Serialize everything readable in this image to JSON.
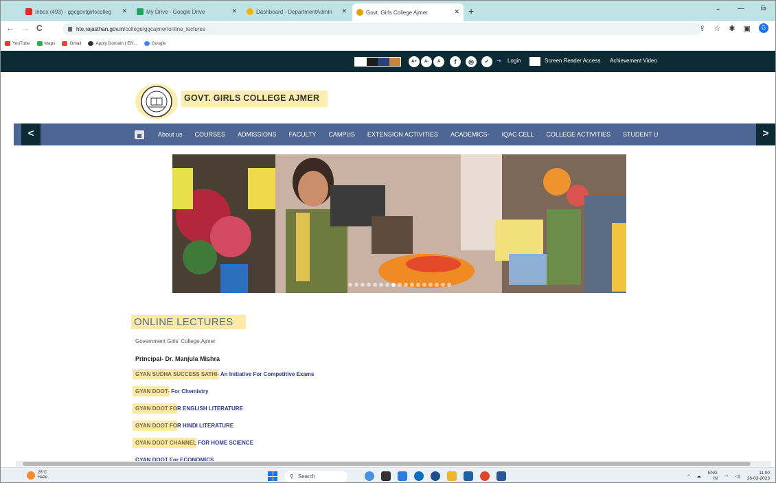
{
  "browser": {
    "tabs": [
      {
        "title": "Inbox (493) - ggcgovtgirlscolleg",
        "color": "#d93025"
      },
      {
        "title": "My Drive - Google Drive",
        "color": "#1fa463"
      },
      {
        "title": "Dashboard - DepartmentAdmin",
        "color": "#f5b400"
      },
      {
        "title": "Govt. Girls College Ajmer",
        "color": "#e8a100"
      }
    ],
    "new_tab": "+",
    "url_host": "hte.rajasthan.gov.in",
    "url_path": "/college/ggcajmer/online_lectures",
    "profile_initial": "G",
    "bookmarks": [
      "YouTube",
      "Maps",
      "Gmail",
      "Apply Domain | ER...",
      "Google"
    ]
  },
  "site_top": {
    "font_buttons": [
      "A+",
      "A-",
      "A"
    ],
    "login": "Login",
    "screen_reader": "Screen Reader Access",
    "achievement": "Achievement Video",
    "color_swatches": [
      "#ffffff",
      "#1c1c1c",
      "#2b3f7a",
      "#c8843a"
    ]
  },
  "header": {
    "college_name": "GOVT. GIRLS COLLEGE AJMER"
  },
  "nav": {
    "prev": "<",
    "next": ">",
    "items": [
      "About us",
      "COURSES",
      "ADMISSIONS",
      "FACULTY",
      "CAMPUS",
      "EXTENSION ACTIVITIES",
      "ACADEMICS-",
      "IQAC CELL",
      "COLLEGE ACTIVITIES",
      "STUDENT U"
    ]
  },
  "slider": {
    "dot_count": 17,
    "active_dot": 7
  },
  "content": {
    "heading": "ONLINE LECTURES",
    "subline": "Government Girls' College,Ajmer",
    "principal": "Principal- Dr. Manjula Mishra",
    "lectures": [
      {
        "prefix": "GYAN SUDHA SUCCESS SATHI-",
        "rest": " An Initiative For Competitive Exams"
      },
      {
        "prefix": "GYAN DOOT-",
        "rest": " For Chemistry"
      },
      {
        "prefix": "GYAN DOOT FO",
        "rest": "R ENGLISH LITERATURE"
      },
      {
        "prefix": "GYAN DOOT FO",
        "rest": "R HINDI LITERATURE"
      },
      {
        "prefix": "GYAN DOOT CHANNEL",
        "rest": "  FOR HOME SCIENCE"
      },
      {
        "prefix": "GYAN DOOT For ECONOMICS",
        "rest": ""
      }
    ]
  },
  "taskbar": {
    "temperature": "26°C",
    "weather_sub": "Haze",
    "search_label": "Search",
    "lang": "ENG",
    "lang_sub": "IN",
    "time": "11:00",
    "date": "26-03-2023"
  }
}
